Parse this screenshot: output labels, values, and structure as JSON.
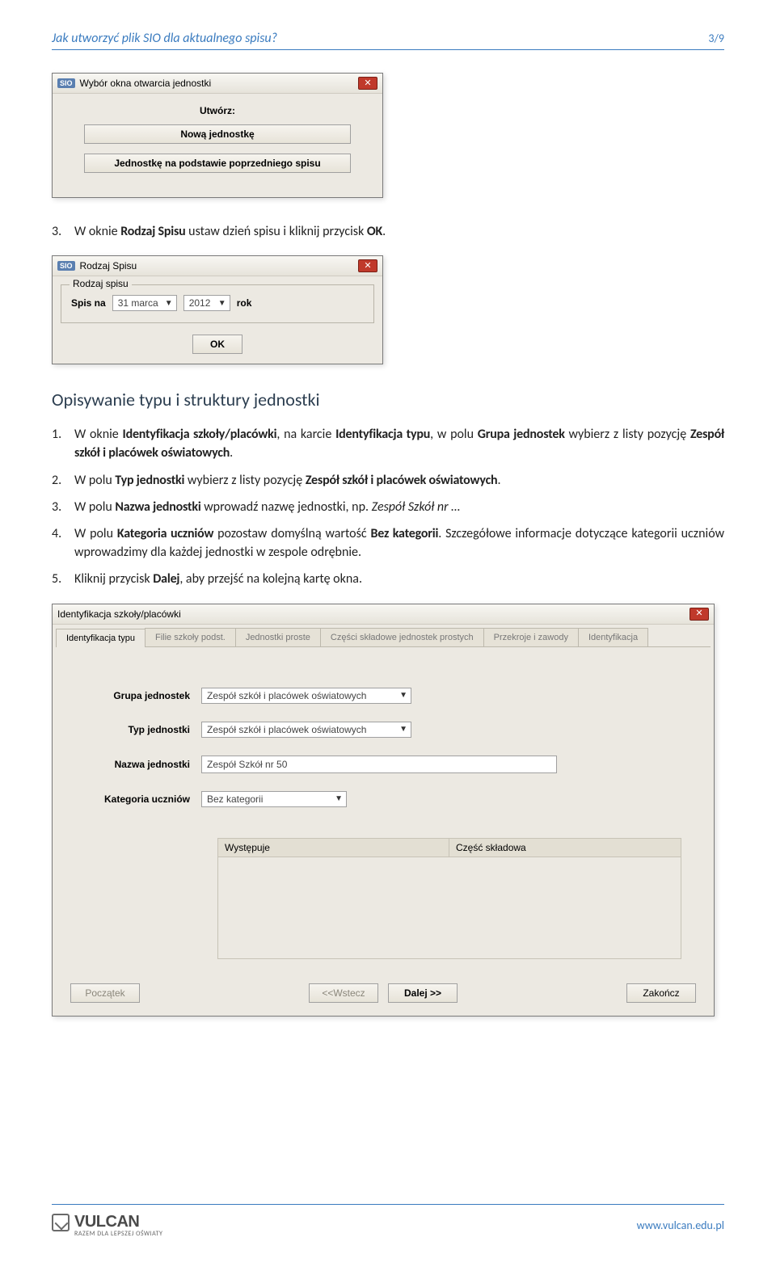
{
  "header": {
    "title": "Jak utworzyć plik SIO dla aktualnego spisu?",
    "page": "3/9"
  },
  "dialog1": {
    "title": "Wybór okna otwarcia jednostki",
    "label": "Utwórz:",
    "btn_new": "Nową jednostkę",
    "btn_prev": "Jednostkę na podstawie poprzedniego spisu"
  },
  "step3": {
    "num": "3.",
    "text_a": "W oknie ",
    "bold_a": "Rodzaj Spisu",
    "text_b": " ustaw dzień spisu i kliknij przycisk ",
    "bold_b": "OK",
    "text_c": "."
  },
  "dialog2": {
    "title": "Rodzaj Spisu",
    "group": "Rodzaj spisu",
    "label": "Spis na",
    "month": "31 marca",
    "year": "2012",
    "rok": "rok",
    "ok": "OK"
  },
  "section_title": "Opisywanie typu i struktury jednostki",
  "s1": {
    "num": "1.",
    "t1": "W oknie ",
    "b1": "Identyfikacja szkoły/placówki",
    "t2": ", na karcie ",
    "b2": "Identyfikacja typu",
    "t3": ", w polu ",
    "b3": "Grupa jednostek",
    "t4": " wybierz z listy pozycję ",
    "b4": "Zespół szkół i placówek oświatowych",
    "t5": "."
  },
  "s2": {
    "num": "2.",
    "t1": "W polu ",
    "b1": "Typ jednostki",
    "t2": " wybierz z listy pozycję ",
    "b2": "Zespół szkół i placówek oświatowych",
    "t3": "."
  },
  "s3": {
    "num": "3.",
    "t1": "W polu ",
    "b1": "Nazwa jednostki",
    "t2": " wprowadź nazwę jednostki, np. ",
    "i1": "Zespół Szkół nr …"
  },
  "s4": {
    "num": "4.",
    "t1": "W polu ",
    "b1": "Kategoria uczniów",
    "t2": " pozostaw domyślną wartość ",
    "b2": "Bez kategorii",
    "t3": ". Szczegółowe informacje dotyczące kategorii uczniów wprowadzimy dla każdej jednostki w zespole odrębnie."
  },
  "s5": {
    "num": "5.",
    "t1": "Kliknij przycisk ",
    "b1": "Dalej",
    "t2": ", aby przejść na kolejną kartę okna."
  },
  "dialog3": {
    "title": "Identyfikacja szkoły/placówki",
    "tabs": [
      "Identyfikacja typu",
      "Filie szkoły podst.",
      "Jednostki proste",
      "Części składowe jednostek prostych",
      "Przekroje i zawody",
      "Identyfikacja"
    ],
    "labels": {
      "grupa": "Grupa jednostek",
      "typ": "Typ jednostki",
      "nazwa": "Nazwa jednostki",
      "kat": "Kategoria uczniów"
    },
    "values": {
      "grupa": "Zespół szkół i placówek oświatowych",
      "typ": "Zespół szkół i placówek oświatowych",
      "nazwa": "Zespół Szkół nr 50",
      "kat": "Bez kategorii"
    },
    "subhead": {
      "a": "Występuje",
      "b": "Część składowa"
    },
    "buttons": {
      "begin": "Początek",
      "back": "<<Wstecz",
      "next": "Dalej >>",
      "end": "Zakończ"
    }
  },
  "footer": {
    "brand": "VULCAN",
    "tag": "RAZEM DLA LEPSZEJ OŚWIATY",
    "url": "www.vulcan.edu.pl"
  }
}
